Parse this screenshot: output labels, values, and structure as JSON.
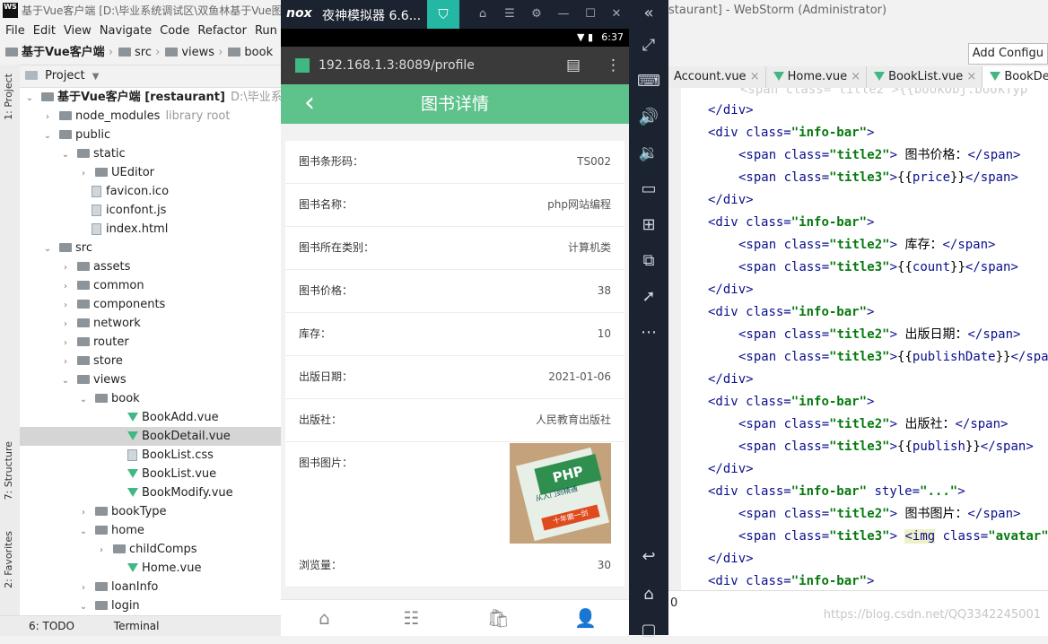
{
  "ide": {
    "title": "基于Vue客户端 [D:\\毕业系统调试区\\双鱼林基于Vue图",
    "logo": "WS",
    "menu": [
      "File",
      "Edit",
      "View",
      "Navigate",
      "Code",
      "Refactor",
      "Run"
    ],
    "breadcrumb": [
      "基于Vue客户端",
      "src",
      "views",
      "book"
    ],
    "project_label": "Project",
    "left_tabs": [
      "1: Project",
      "7: Structure",
      "2: Favorites"
    ],
    "tree": [
      {
        "label": "基于Vue客户端 [restaurant]",
        "extra": "D:\\毕业系统调试",
        "icon": "folder",
        "depth": 0,
        "arrow": "down"
      },
      {
        "label": "node_modules",
        "extra": "library root",
        "icon": "folder",
        "depth": 1,
        "arrow": "right"
      },
      {
        "label": "public",
        "icon": "folder",
        "depth": 1,
        "arrow": "down"
      },
      {
        "label": "static",
        "icon": "folder",
        "depth": 2,
        "arrow": "down"
      },
      {
        "label": "UEditor",
        "icon": "folder",
        "depth": 3,
        "arrow": "right"
      },
      {
        "label": "favicon.ico",
        "icon": "file",
        "depth": 3
      },
      {
        "label": "iconfont.js",
        "icon": "file",
        "depth": 3
      },
      {
        "label": "index.html",
        "icon": "file",
        "depth": 3
      },
      {
        "label": "src",
        "icon": "folder",
        "depth": 1,
        "arrow": "down"
      },
      {
        "label": "assets",
        "icon": "folder",
        "depth": 2,
        "arrow": "right"
      },
      {
        "label": "common",
        "icon": "folder",
        "depth": 2,
        "arrow": "right"
      },
      {
        "label": "components",
        "icon": "folder",
        "depth": 2,
        "arrow": "right"
      },
      {
        "label": "network",
        "icon": "folder",
        "depth": 2,
        "arrow": "right"
      },
      {
        "label": "router",
        "icon": "folder",
        "depth": 2,
        "arrow": "right"
      },
      {
        "label": "store",
        "icon": "folder",
        "depth": 2,
        "arrow": "right"
      },
      {
        "label": "views",
        "icon": "folder",
        "depth": 2,
        "arrow": "down"
      },
      {
        "label": "book",
        "icon": "folder",
        "depth": 3,
        "arrow": "down"
      },
      {
        "label": "BookAdd.vue",
        "icon": "vue",
        "depth": 5
      },
      {
        "label": "BookDetail.vue",
        "icon": "vue",
        "depth": 5,
        "selected": true
      },
      {
        "label": "BookList.css",
        "icon": "file",
        "depth": 5
      },
      {
        "label": "BookList.vue",
        "icon": "vue",
        "depth": 5
      },
      {
        "label": "BookModify.vue",
        "icon": "vue",
        "depth": 5
      },
      {
        "label": "bookType",
        "icon": "folder",
        "depth": 3,
        "arrow": "right"
      },
      {
        "label": "home",
        "icon": "folder",
        "depth": 3,
        "arrow": "down"
      },
      {
        "label": "childComps",
        "icon": "folder",
        "depth": 4,
        "arrow": "right"
      },
      {
        "label": "Home.vue",
        "icon": "vue",
        "depth": 5
      },
      {
        "label": "loanInfo",
        "icon": "folder",
        "depth": 3,
        "arrow": "right"
      },
      {
        "label": "login",
        "icon": "folder",
        "depth": 3,
        "arrow": "down"
      }
    ],
    "bottom": {
      "todo": "6: TODO",
      "terminal": "Terminal"
    }
  },
  "emulator": {
    "title": "夜神模拟器 6.6...",
    "logo": "nox",
    "time": "6:37",
    "url": "192.168.1.3:8089/profile"
  },
  "app": {
    "header_title": "图书详情",
    "back": "‹",
    "rows": [
      {
        "label": "图书条形码：",
        "value": "TS002"
      },
      {
        "label": "图书名称：",
        "value": "php网站编程"
      },
      {
        "label": "图书所在类别：",
        "value": "计算机类"
      },
      {
        "label": "图书价格：",
        "value": "38"
      },
      {
        "label": "库存：",
        "value": "10"
      },
      {
        "label": "出版日期：",
        "value": "2021-01-06"
      },
      {
        "label": "出版社：",
        "value": "人民教育出版社"
      }
    ],
    "image_label": "图书图片：",
    "cover_text": {
      "brand": "PHP",
      "line1": "从入门到精通",
      "line2": "十年磨一剑"
    },
    "views_label": "浏览量：",
    "views_value": "30",
    "tabs": [
      "home-icon",
      "list-icon",
      "cart-icon",
      "user-icon"
    ]
  },
  "editor": {
    "title": "staurant] - WebStorm (Administrator)",
    "add_config": "Add Configu",
    "tabs": [
      "Account.vue",
      "Home.vue",
      "BookList.vue",
      "BookDetail.vue"
    ],
    "status_col": "0",
    "watermark": "https://blog.csdn.net/QQ3342245001"
  },
  "colors": {
    "app_green": "#5ec28b",
    "emu_dark": "#1c2330",
    "vue_green": "#41b883"
  }
}
